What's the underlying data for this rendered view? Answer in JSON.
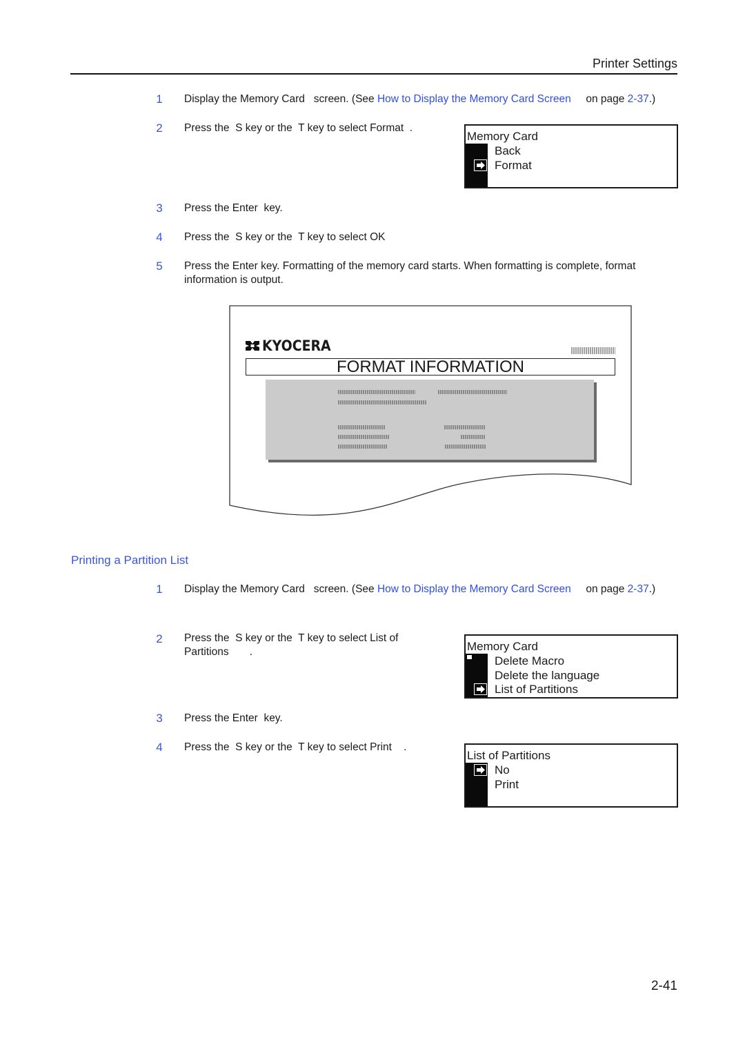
{
  "header": {
    "section_title": "Printer Settings"
  },
  "format_section": {
    "steps": [
      {
        "num": "1",
        "text_before": "Display the Memory Card   screen. (See ",
        "link": "How to Display the Memory Card Screen",
        "text_mid": "     on page ",
        "page_link": "2-37",
        "text_after": ".)"
      },
      {
        "num": "2",
        "text": "Press the  S key or the  T key to select Format  ."
      },
      {
        "num": "3",
        "text": "Press the Enter  key."
      },
      {
        "num": "4",
        "text": "Press the  S key or the  T key to select OK"
      },
      {
        "num": "5",
        "text": "Press the Enter  key. Formatting of the memory card starts. When formatting is complete, format information is output."
      }
    ],
    "lcd": {
      "title": "Memory Card",
      "items": [
        "Back",
        "Format"
      ],
      "selected_index": 1,
      "cursor_icon": "arrow-right-icon"
    },
    "printout": {
      "logo_text": "KYOCERA",
      "heading": "FORMAT INFORMATION"
    }
  },
  "partition_section": {
    "title": "Printing a Partition List",
    "steps": [
      {
        "num": "1",
        "text_before": "Display the Memory Card   screen. (See ",
        "link": "How to Display the Memory Card Screen",
        "text_mid": "     on page ",
        "page_link": "2-37",
        "text_after": ".)"
      },
      {
        "num": "2",
        "text_line1": "Press the  S key or the  T key to select List of",
        "text_line2": "Partitions       ."
      },
      {
        "num": "3",
        "text": "Press the Enter  key."
      },
      {
        "num": "4",
        "text": "Press the  S key or the  T key to select Print    ."
      }
    ],
    "lcd1": {
      "title": "Memory Card",
      "items": [
        "Delete Macro",
        "Delete the language",
        "List of Partitions"
      ],
      "selected_index": 2,
      "cursor_icon": "arrow-right-icon"
    },
    "lcd2": {
      "title": "List of Partitions",
      "items": [
        "No",
        "Print"
      ],
      "selected_index": 0,
      "cursor_icon": "arrow-right-icon"
    }
  },
  "footer": {
    "page_number": "2-41"
  },
  "colors": {
    "accent": "#3a56d8",
    "link": "#2f4fe0",
    "text": "#1a1a1a"
  }
}
